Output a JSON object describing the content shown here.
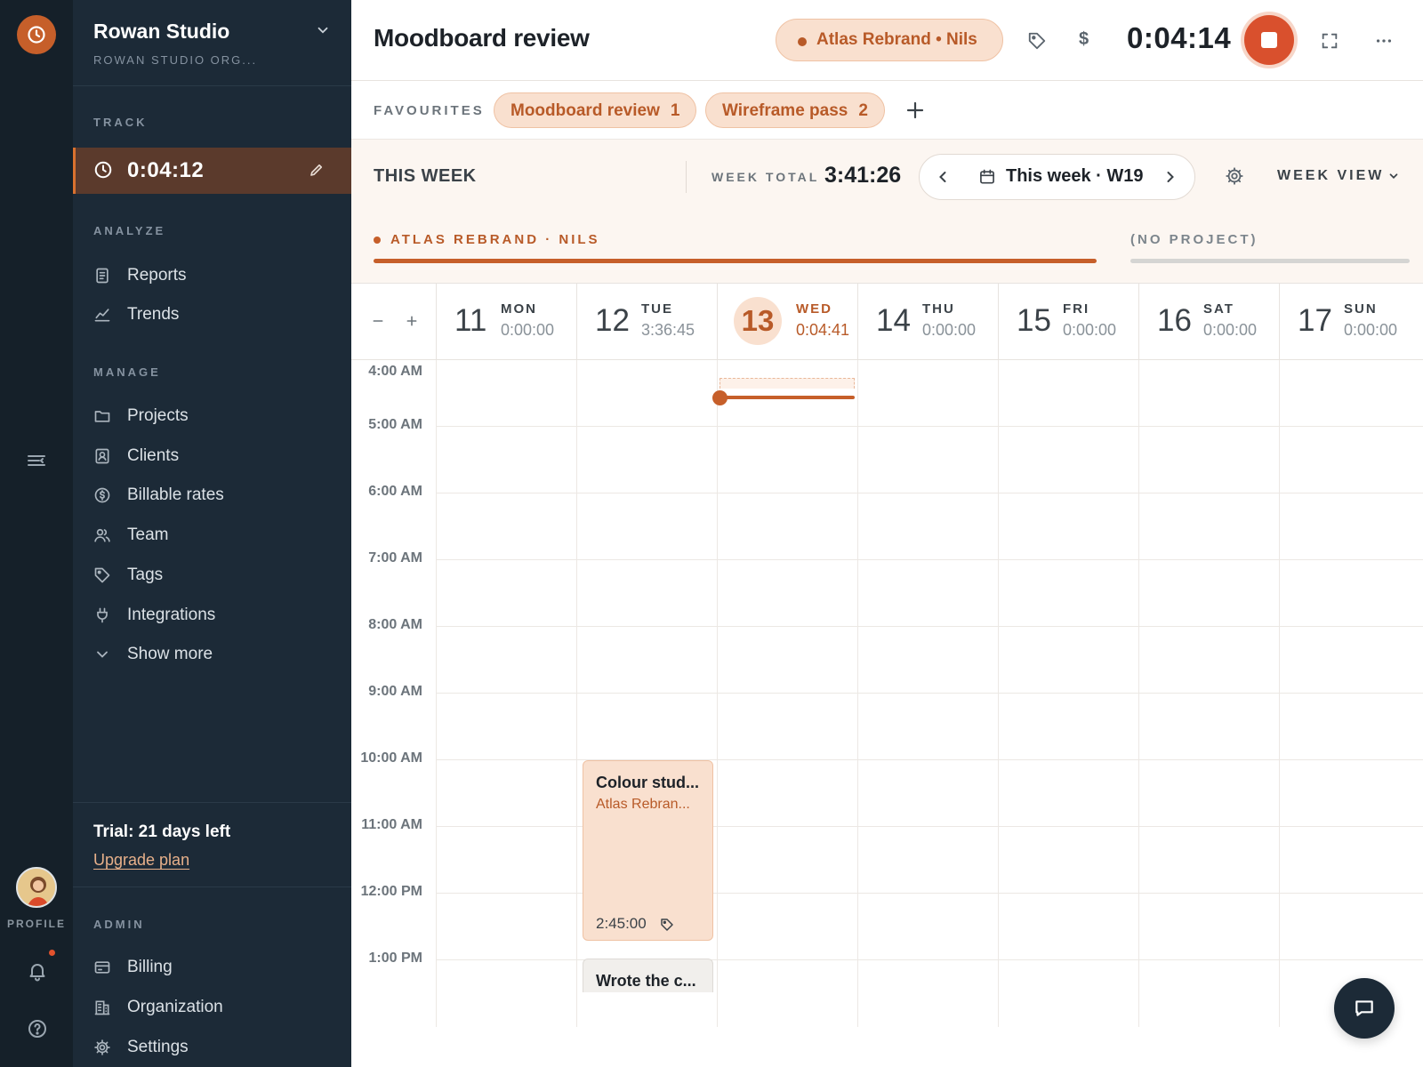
{
  "org": {
    "name": "Rowan Studio",
    "subtitle": "ROWAN STUDIO ORG..."
  },
  "sidebar": {
    "track_label": "TRACK",
    "track_time": "0:04:12",
    "analyze_label": "ANALYZE",
    "analyze_items": [
      {
        "label": "Reports",
        "icon": "reports-icon"
      },
      {
        "label": "Trends",
        "icon": "trends-icon"
      }
    ],
    "manage_label": "MANAGE",
    "manage_items": [
      {
        "label": "Projects",
        "icon": "folder-icon"
      },
      {
        "label": "Clients",
        "icon": "client-icon"
      },
      {
        "label": "Billable rates",
        "icon": "dollar-icon"
      },
      {
        "label": "Team",
        "icon": "team-icon"
      },
      {
        "label": "Tags",
        "icon": "tag-icon"
      },
      {
        "label": "Integrations",
        "icon": "plug-icon"
      },
      {
        "label": "Show more",
        "icon": "chevron-down-icon"
      }
    ],
    "trial_title": "Trial: 21 days left",
    "trial_link": "Upgrade plan",
    "admin_label": "ADMIN",
    "admin_items": [
      {
        "label": "Billing",
        "icon": "card-icon"
      },
      {
        "label": "Organization",
        "icon": "building-icon"
      },
      {
        "label": "Settings",
        "icon": "gear-icon"
      }
    ]
  },
  "rail": {
    "profile_label": "PROFILE"
  },
  "topbar": {
    "task_title": "Moodboard review",
    "project_pill": "Atlas Rebrand  •  Nils",
    "dollar": "$",
    "running_time": "0:04:14"
  },
  "favourites": {
    "label": "FAVOURITES",
    "items": [
      {
        "label": "Moodboard review",
        "num": "1"
      },
      {
        "label": "Wireframe pass",
        "num": "2"
      }
    ]
  },
  "week": {
    "this_week": "THIS WEEK",
    "total_label": "WEEK TOTAL",
    "total": "3:41:26",
    "range_label": "This week · W19",
    "view_label": "WEEK VIEW"
  },
  "projects_bar": {
    "active": "ATLAS REBRAND · NILS",
    "active_share": 0.72,
    "no_project": "(NO PROJECT)",
    "no_project_share": 0.28
  },
  "days": [
    {
      "num": "11",
      "name": "MON",
      "total": "0:00:00"
    },
    {
      "num": "12",
      "name": "TUE",
      "total": "3:36:45"
    },
    {
      "num": "13",
      "name": "WED",
      "total": "0:04:41",
      "today": true
    },
    {
      "num": "14",
      "name": "THU",
      "total": "0:00:00"
    },
    {
      "num": "15",
      "name": "FRI",
      "total": "0:00:00"
    },
    {
      "num": "16",
      "name": "SAT",
      "total": "0:00:00"
    },
    {
      "num": "17",
      "name": "SUN",
      "total": "0:00:00"
    }
  ],
  "hours": [
    "4:00 AM",
    "5:00 AM",
    "6:00 AM",
    "7:00 AM",
    "8:00 AM",
    "9:00 AM",
    "10:00 AM",
    "11:00 AM",
    "12:00 PM",
    "1:00 PM"
  ],
  "events": [
    {
      "title": "Colour stud...",
      "project": "Atlas Rebran...",
      "duration": "2:45:00"
    },
    {
      "title": "Wrote the c..."
    }
  ],
  "colors": {
    "accent": "#c65f2a",
    "stop": "#d9502d",
    "sidebar": "#1c2a37",
    "rail": "#152029",
    "chip_bg": "#f9e0cf"
  }
}
